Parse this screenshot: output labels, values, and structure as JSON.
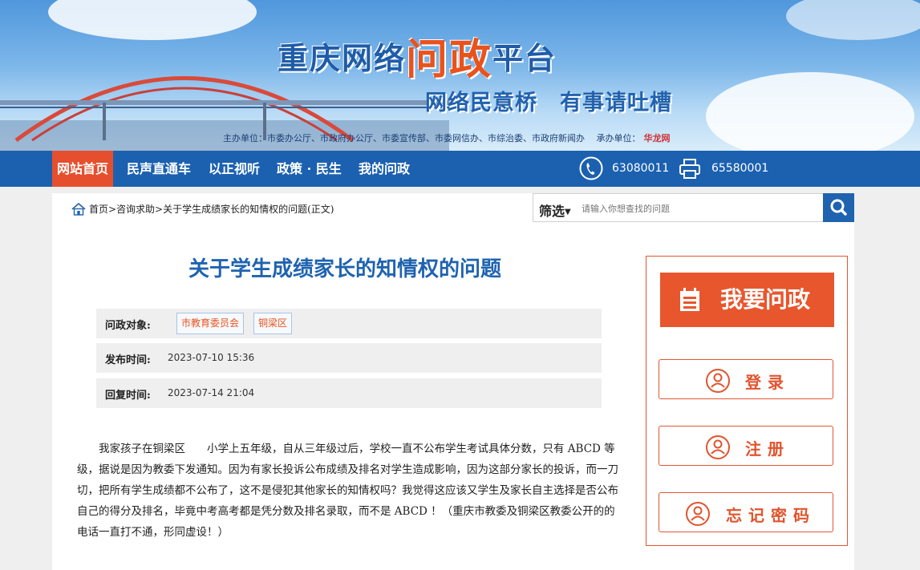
{
  "banner": {
    "title_pre": "重庆网络",
    "title_highlight": "问政",
    "title_post": "平台",
    "slogan_1": "网络民意桥",
    "slogan_2": "有事请吐槽",
    "sponsor": "主办单位：市委办公厅、市政府办公厅、市委宣传部、市委网信办、市综治委、市政府新闻办　 承办单位：",
    "sponsor_logo": "华龙网"
  },
  "nav": {
    "items": [
      {
        "label": "网站首页",
        "active": true
      },
      {
        "label": "民声直通车"
      },
      {
        "label": "以正视听"
      },
      {
        "label": "政策 · 民生"
      },
      {
        "label": "我的问政"
      }
    ],
    "phone": "63080011",
    "fax": "65580001"
  },
  "breadcrumb": "首页>咨询求助>关于学生成绩家长的知情权的问题(正文)",
  "search": {
    "filter_label": "筛选",
    "placeholder": "请输入你想查找的问题"
  },
  "question": {
    "title": "关于学生成绩家长的知情权的问题",
    "target_label": "问政对象:",
    "targets": [
      "市教育委员会",
      "铜梁区"
    ],
    "publish_label": "发布时间:",
    "publish_time": "2023-07-10 15:36",
    "reply_label": "回复时间:",
    "reply_time": "2023-07-14 21:04",
    "content": "我家孩子在铜梁区　　小学上五年级，自从三年级过后，学校一直不公布学生考试具体分数，只有 ABCD 等级，据说是因为教委下发通知。因为有家长投诉公布成绩及排名对学生造成影响，因为这部分家长的投诉，而一刀切，把所有学生成绩都不公布了，这不是侵犯其他家长的知情权吗？我觉得这应该又学生及家长自主选择是否公布自己的得分及排名，毕竟中考高考都是凭分数及排名录取，而不是 ABCD ！（重庆市教委及铜梁区教委公开的的电话一直打不通，形同虚设！）"
  },
  "panel": {
    "ask_label": "我要问政",
    "login_label": "登录",
    "register_label": "注册",
    "forgot_label": "忘记密码"
  },
  "colors": {
    "nav_bg": "#1c61b0",
    "accent": "#e8531d",
    "title_blue": "#1f63b0"
  }
}
